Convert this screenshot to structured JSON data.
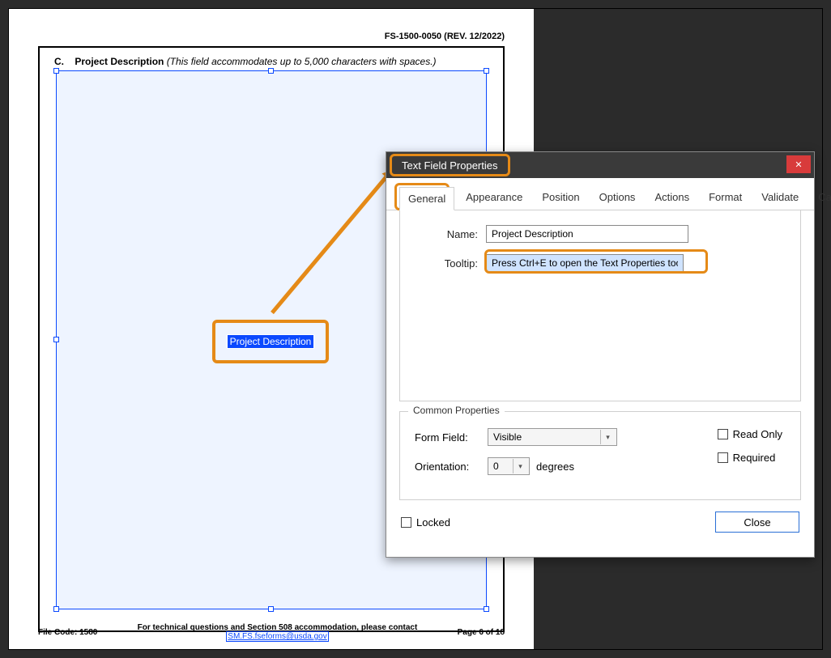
{
  "doc": {
    "header_form_id": "FS-1500-0050 (REV. 12/2022)",
    "section_letter": "C.",
    "section_title": "Project Description",
    "section_note": "(This field accommodates up to 5,000 characters with spaces.)",
    "field_label": "Project Description",
    "footer": {
      "file_code": "File Code: 1580",
      "center_text": "For technical questions and Section 508 accommodation, please contact ",
      "link_text": "SM.FS.fseforms@usda.gov",
      "page": "Page 6 of 18"
    }
  },
  "dialog": {
    "title": "Text Field Properties",
    "tabs": [
      "General",
      "Appearance",
      "Position",
      "Options",
      "Actions",
      "Format",
      "Validate",
      "Calculate"
    ],
    "name_label": "Name:",
    "name_value": "Project Description",
    "tooltip_label": "Tooltip:",
    "tooltip_value": "Press Ctrl+E to open the Text Properties tooll",
    "common": {
      "legend": "Common Properties",
      "form_field_label": "Form Field:",
      "form_field_value": "Visible",
      "orientation_label": "Orientation:",
      "orientation_value": "0",
      "orientation_unit": "degrees",
      "readonly_label": "Read Only",
      "required_label": "Required"
    },
    "locked_label": "Locked",
    "close_label": "Close"
  }
}
